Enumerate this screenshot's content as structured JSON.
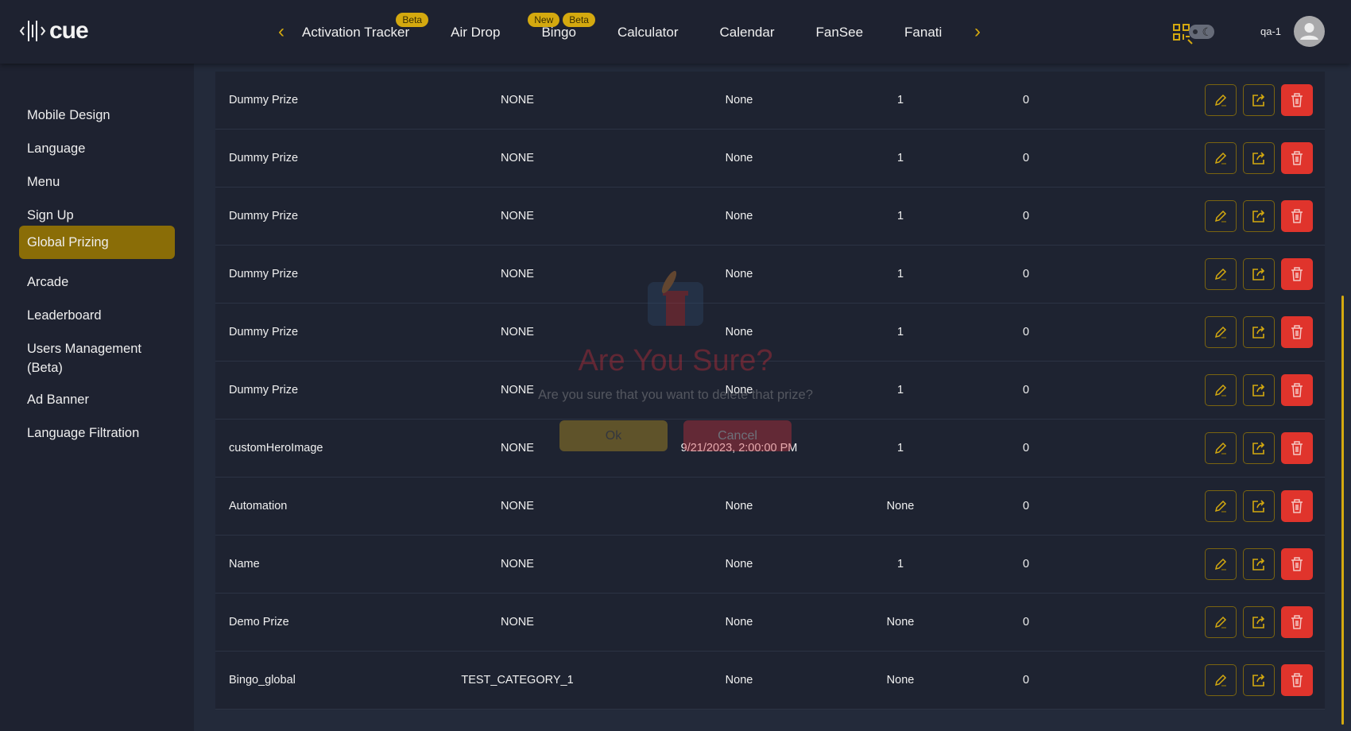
{
  "header": {
    "logo": "cue",
    "nav": [
      {
        "label": "Activation Tracker",
        "badges": [
          "Beta"
        ]
      },
      {
        "label": "Air Drop",
        "badges": []
      },
      {
        "label": "Bingo",
        "badges": [
          "New",
          "Beta"
        ]
      },
      {
        "label": "Calculator",
        "badges": []
      },
      {
        "label": "Calendar",
        "badges": []
      },
      {
        "label": "FanSee",
        "badges": []
      },
      {
        "label": "Fanati",
        "badges": []
      }
    ],
    "user": "qa-1",
    "accent": "#d4a90f"
  },
  "sidebar": {
    "items": [
      "Mobile Design",
      "Language",
      "Menu",
      "Sign Up",
      "Global Prizing",
      "Arcade",
      "Leaderboard",
      "Users Management (Beta)",
      "Ad Banner",
      "Language Filtration"
    ],
    "active": "Global Prizing"
  },
  "table": {
    "rows": [
      [
        "Dummy Prize",
        "NONE",
        "None",
        "1",
        "0"
      ],
      [
        "Dummy Prize",
        "NONE",
        "None",
        "1",
        "0"
      ],
      [
        "Dummy Prize",
        "NONE",
        "None",
        "1",
        "0"
      ],
      [
        "Dummy Prize",
        "NONE",
        "None",
        "1",
        "0"
      ],
      [
        "Dummy Prize",
        "NONE",
        "None",
        "1",
        "0"
      ],
      [
        "Dummy Prize",
        "NONE",
        "None",
        "1",
        "0"
      ],
      [
        "customHeroImage",
        "NONE",
        "9/21/2023, 2:00:00 PM",
        "1",
        "0"
      ],
      [
        "Automation",
        "NONE",
        "None",
        "None",
        "0"
      ],
      [
        "Name",
        "NONE",
        "None",
        "1",
        "0"
      ],
      [
        "Demo Prize",
        "NONE",
        "None",
        "None",
        "0"
      ],
      [
        "Bingo_global",
        "TEST_CATEGORY_1",
        "None",
        "None",
        "0"
      ]
    ]
  },
  "modal": {
    "title": "Are You Sure?",
    "text": "Are you sure that you want to delete that prize?",
    "ok": "Ok",
    "cancel": "Cancel"
  }
}
